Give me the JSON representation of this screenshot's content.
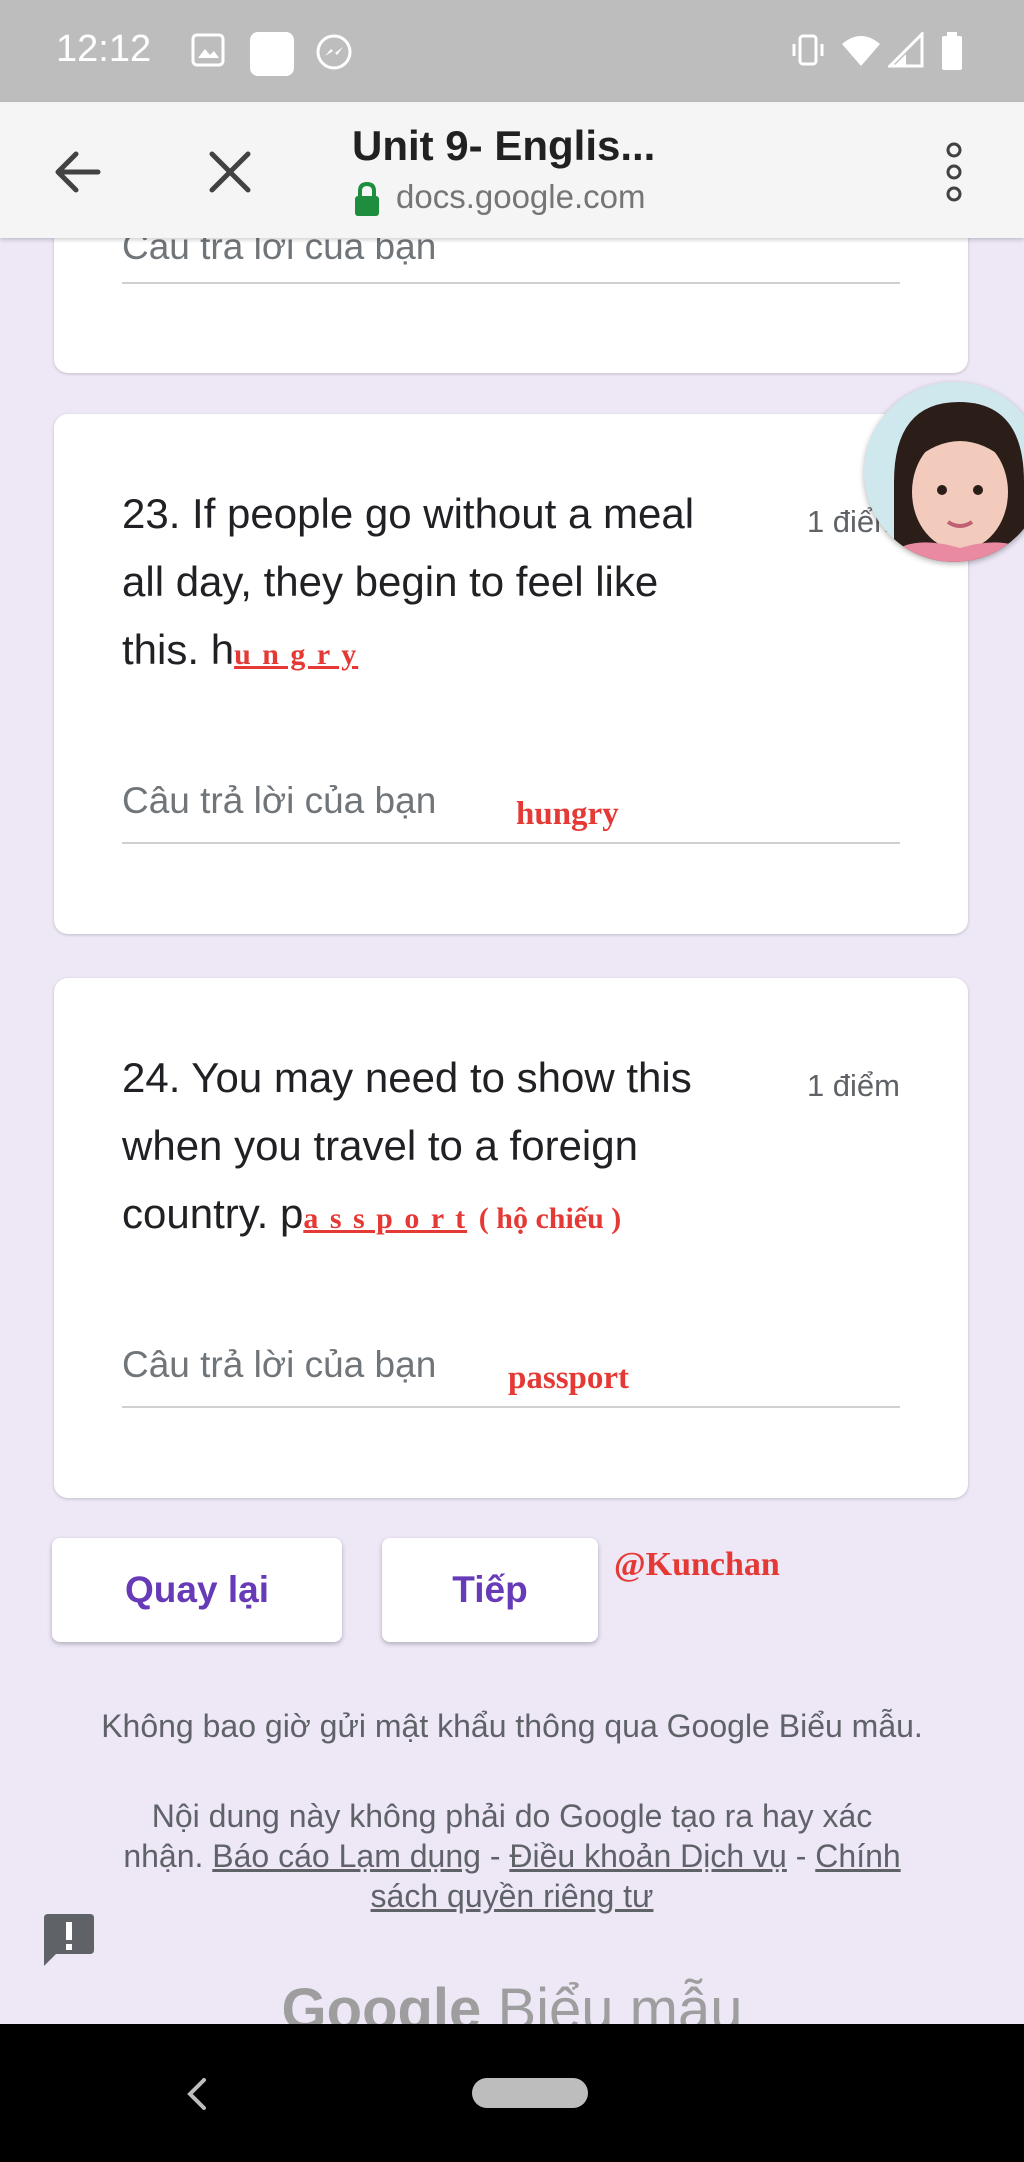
{
  "status_bar": {
    "time": "12:12"
  },
  "browser": {
    "title": "Unit 9- Englis...",
    "url": "docs.google.com"
  },
  "prev_card": {
    "placeholder": "Câu trả lời của bạn"
  },
  "questions": [
    {
      "text_line1": "23. If people go without a meal",
      "text_line2": "all day, they begin to feel like",
      "text_line3": "this. h",
      "points": "1 điểm",
      "hint_letters": "u n g r y",
      "placeholder": "Câu trả lời của bạn",
      "answer": "hungry"
    },
    {
      "text_line1": "24. You may need to show this",
      "text_line2": "when you travel to a foreign",
      "text_line3": "country. p",
      "points": "1 điểm",
      "hint_letters": "a s s p o r t",
      "hint_translation": "( hộ chiếu )",
      "placeholder": "Câu trả lời của bạn",
      "answer": "passport"
    }
  ],
  "buttons": {
    "back": "Quay lại",
    "next": "Tiếp"
  },
  "watermark": "@Kunchan",
  "footer": {
    "password_notice": "Không bao giờ gửi mật khẩu thông qua Google Biểu mẫu.",
    "disclaimer_line1": "Nội dung này không phải do Google tạo ra hay xác",
    "disclaimer_prefix": "nhận.",
    "link_report": "Báo cáo Lạm dụng",
    "separator": "-",
    "link_terms": "Điều khoản Dịch vụ",
    "link_privacy_part1": "Chính",
    "link_privacy_part2": "sách quyền riêng tư",
    "logo_google": "Google",
    "logo_forms": "Biểu mẫu"
  },
  "colors": {
    "accent": "#673ab7",
    "annotation": "#e53935",
    "background": "#ede7f6"
  }
}
